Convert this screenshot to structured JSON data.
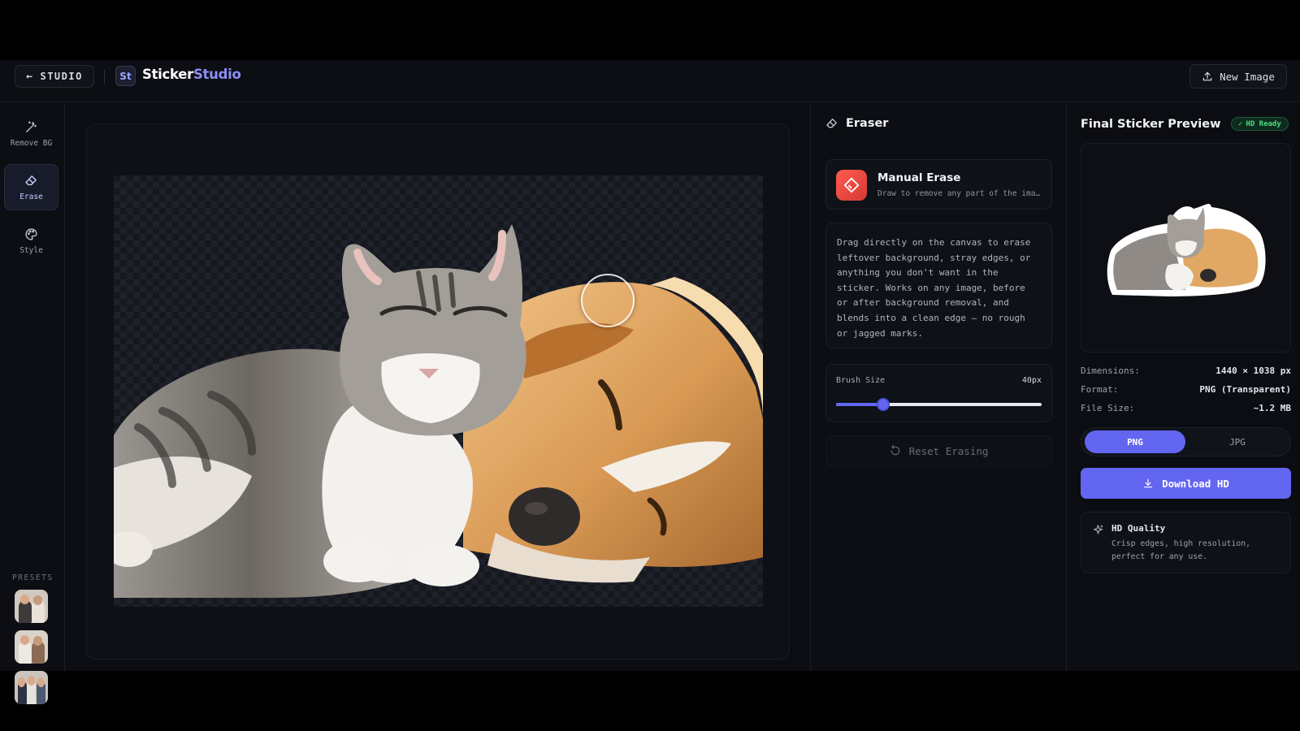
{
  "header": {
    "back_label": "STUDIO",
    "logo_badge": "St",
    "logo_part1": "Sticker",
    "logo_part2": "Studio",
    "new_image_label": "New Image"
  },
  "rail": {
    "tools": [
      {
        "label": "Remove BG",
        "icon": "magic-wand-icon"
      },
      {
        "label": "Erase",
        "icon": "eraser-icon",
        "active": true
      },
      {
        "label": "Style",
        "icon": "palette-icon"
      }
    ],
    "presets_label": "PRESETS"
  },
  "eraser": {
    "title": "Eraser",
    "mode_name": "Manual Erase",
    "mode_desc": "Draw to remove any part of the image",
    "description": "Drag directly on the canvas to erase leftover background, stray edges, or anything you don't want in the sticker. Works on any image, before or after background removal, and blends into a clean edge — no rough or jagged marks.",
    "brush_label": "Brush Size",
    "brush_value": "40px",
    "brush_fraction": 0.23,
    "reset_label": "Reset Erasing"
  },
  "preview": {
    "title": "Final Sticker Preview",
    "badge": "HD Ready",
    "meta": [
      {
        "key": "Dimensions:",
        "value": "1440 × 1038 px"
      },
      {
        "key": "Format:",
        "value": "PNG (Transparent)"
      },
      {
        "key": "File Size:",
        "value": "~1.2 MB"
      }
    ],
    "format_png": "PNG",
    "format_jpg": "JPG",
    "download_label": "Download HD",
    "quality_title": "HD Quality",
    "quality_desc": "Crisp edges, high resolution, perfect for any use."
  },
  "colors": {
    "accent": "#6366f1",
    "success": "#4ade80",
    "eraser_red": "#ff5a4e"
  }
}
